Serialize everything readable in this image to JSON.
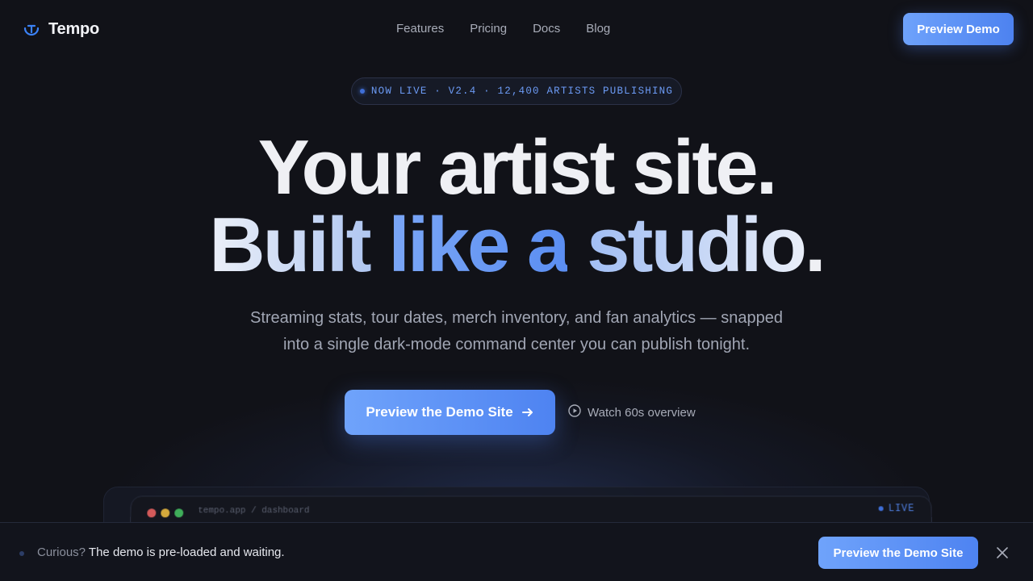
{
  "brand": {
    "name": "Tempo",
    "icon": "tempo-logo-icon",
    "accent": "#3b82f6"
  },
  "nav": {
    "links": [
      "Features",
      "Pricing",
      "Docs",
      "Blog"
    ],
    "cta_label": "Preview Demo"
  },
  "badge": {
    "text": "NOW LIVE · V2.4 · 12,400 ARTISTS PUBLISHING"
  },
  "hero": {
    "line1": "Your artist site.",
    "line2": {
      "built": "Built ",
      "accent": "like a",
      "studio": " studio",
      "dot": "."
    },
    "subtitle_line1": "Streaming stats, tour dates, merch inventory, and fan analytics — snapped",
    "subtitle_line2": "into a single dark-mode command center you can publish tonight.",
    "cta_label": "Preview the Demo Site",
    "watch_label": "Watch 60s overview"
  },
  "preview": {
    "url": "tempo.app / dashboard",
    "live_label": "LIVE"
  },
  "bottom_bar": {
    "lead": "Curious?",
    "message": " The demo is pre-loaded and waiting.",
    "cta_label": "Preview the Demo Site"
  },
  "colors": {
    "background": "#111218",
    "accent": "#5b8ef2",
    "text": "#e8e9ee"
  }
}
